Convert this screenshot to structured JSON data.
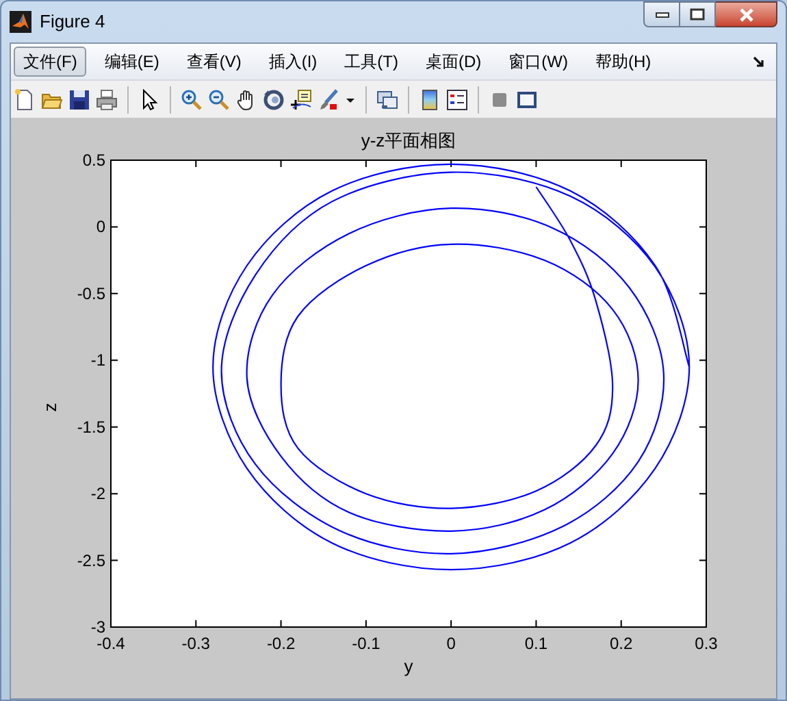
{
  "window": {
    "title": "Figure 4"
  },
  "menu": [
    {
      "label": "文件(F)",
      "selected": true
    },
    {
      "label": "编辑(E)",
      "selected": false
    },
    {
      "label": "查看(V)",
      "selected": false
    },
    {
      "label": "插入(I)",
      "selected": false
    },
    {
      "label": "工具(T)",
      "selected": false
    },
    {
      "label": "桌面(D)",
      "selected": false
    },
    {
      "label": "窗口(W)",
      "selected": false
    },
    {
      "label": "帮助(H)",
      "selected": false
    }
  ],
  "figure": {
    "chart_data": {
      "type": "line",
      "title": "y-z平面相图",
      "xlabel": "y",
      "ylabel": "z",
      "xlim": [
        -0.4,
        0.3
      ],
      "ylim": [
        -3,
        0.5
      ],
      "xticks": [
        {
          "value": -0.4,
          "label": "-0.4"
        },
        {
          "value": -0.3,
          "label": "-0.3"
        },
        {
          "value": -0.2,
          "label": "-0.2"
        },
        {
          "value": -0.1,
          "label": "-0.1"
        },
        {
          "value": 0,
          "label": "0"
        },
        {
          "value": 0.1,
          "label": "0.1"
        },
        {
          "value": 0.2,
          "label": "0.2"
        },
        {
          "value": 0.3,
          "label": "0.3"
        }
      ],
      "yticks": [
        {
          "value": 0.5,
          "label": "0.5"
        },
        {
          "value": 0,
          "label": "0"
        },
        {
          "value": -0.5,
          "label": "-0.5"
        },
        {
          "value": -1,
          "label": "-1"
        },
        {
          "value": -1.5,
          "label": "-1.5"
        },
        {
          "value": -2,
          "label": "-2"
        },
        {
          "value": -2.5,
          "label": "-2.5"
        },
        {
          "value": -3,
          "label": "-3"
        }
      ],
      "x": [
        0.1,
        0.14,
        0.17,
        0.19,
        0.17,
        0.1,
        0,
        -0.1,
        -0.18,
        -0.2,
        -0.18,
        -0.1,
        0,
        0.11,
        0.19,
        0.22,
        0.19,
        0.11,
        0,
        -0.12,
        -0.2,
        -0.24,
        -0.21,
        -0.12,
        0,
        0.12,
        0.21,
        0.25,
        0.22,
        0.13,
        0,
        -0.13,
        -0.23,
        -0.27,
        -0.23,
        -0.14,
        0,
        0.14,
        0.24,
        0.28,
        0.24,
        0.14,
        0,
        -0.14,
        -0.24,
        -0.28,
        -0.24,
        -0.14,
        0,
        0.14,
        0.24,
        0.28
      ],
      "series": [
        {
          "color": "#0000ff",
          "values": [
            0.3,
            -0.1,
            -0.55,
            -1.2,
            -1.64,
            -1.98,
            -2.11,
            -2,
            -1.66,
            -1.18,
            -0.67,
            -0.29,
            -0.13,
            -0.25,
            -0.62,
            -1.15,
            -1.7,
            -2.12,
            -2.28,
            -2.14,
            -1.72,
            -1.13,
            -0.51,
            -0.05,
            0.14,
            -0.01,
            -0.46,
            -1.1,
            -1.76,
            -2.25,
            -2.45,
            -2.28,
            -1.78,
            -1.08,
            -0.36,
            0.19,
            0.41,
            0.23,
            -0.3,
            -1.05,
            -1.81,
            -2.37,
            -2.57,
            -2.37,
            -1.81,
            -1.05,
            -0.29,
            0.27,
            0.47,
            0.27,
            -0.29,
            -1.05
          ]
        }
      ]
    }
  }
}
